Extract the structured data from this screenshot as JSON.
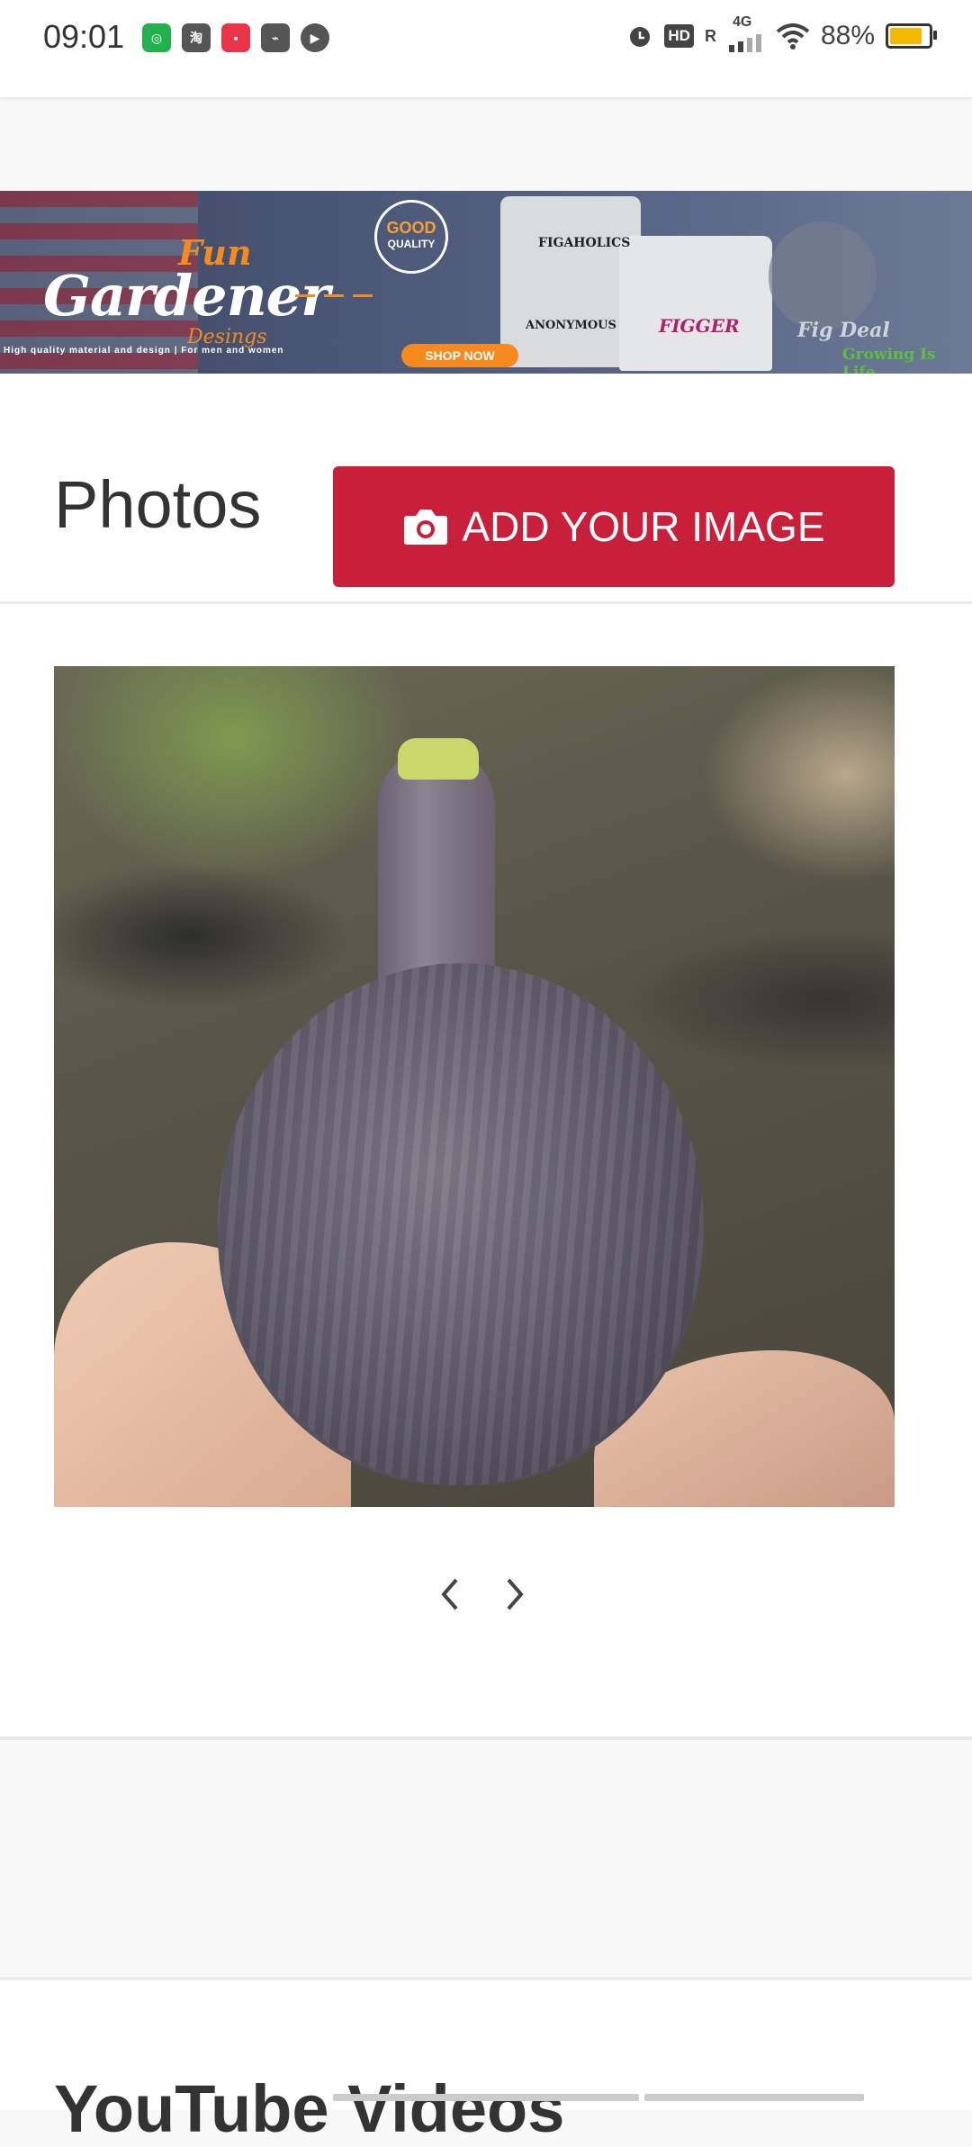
{
  "status_bar": {
    "time": "09:01",
    "battery_percent": "88%",
    "network": "4G",
    "hd_label": "HD",
    "roaming": "R",
    "battery_level": 0.88,
    "battery_color": "#f5b800",
    "app_icons": [
      "wechat-pay-icon",
      "taobao-icon",
      "app-red-icon",
      "pen-icon",
      "play-icon"
    ]
  },
  "banner": {
    "brand_fun": "Fun",
    "brand_name": "Gardener",
    "brand_designs": "Desings",
    "tagline": "High quality material and design | For men and women",
    "badge_line1": "GOOD",
    "badge_line2": "QUALITY",
    "cta": "SHOP NOW",
    "shirt1_top": "FIGAHOLICS",
    "shirt1_bottom": "ANONYMOUS",
    "shirt2_text": "FIGGER",
    "mascot_text": "Fig Deal",
    "slogan": "Growing Is Life"
  },
  "photos": {
    "title": "Photos",
    "add_button_label": "ADD YOUR IMAGE",
    "accent_color": "#c8203a"
  },
  "youtube": {
    "title": "YouTube Videos"
  }
}
